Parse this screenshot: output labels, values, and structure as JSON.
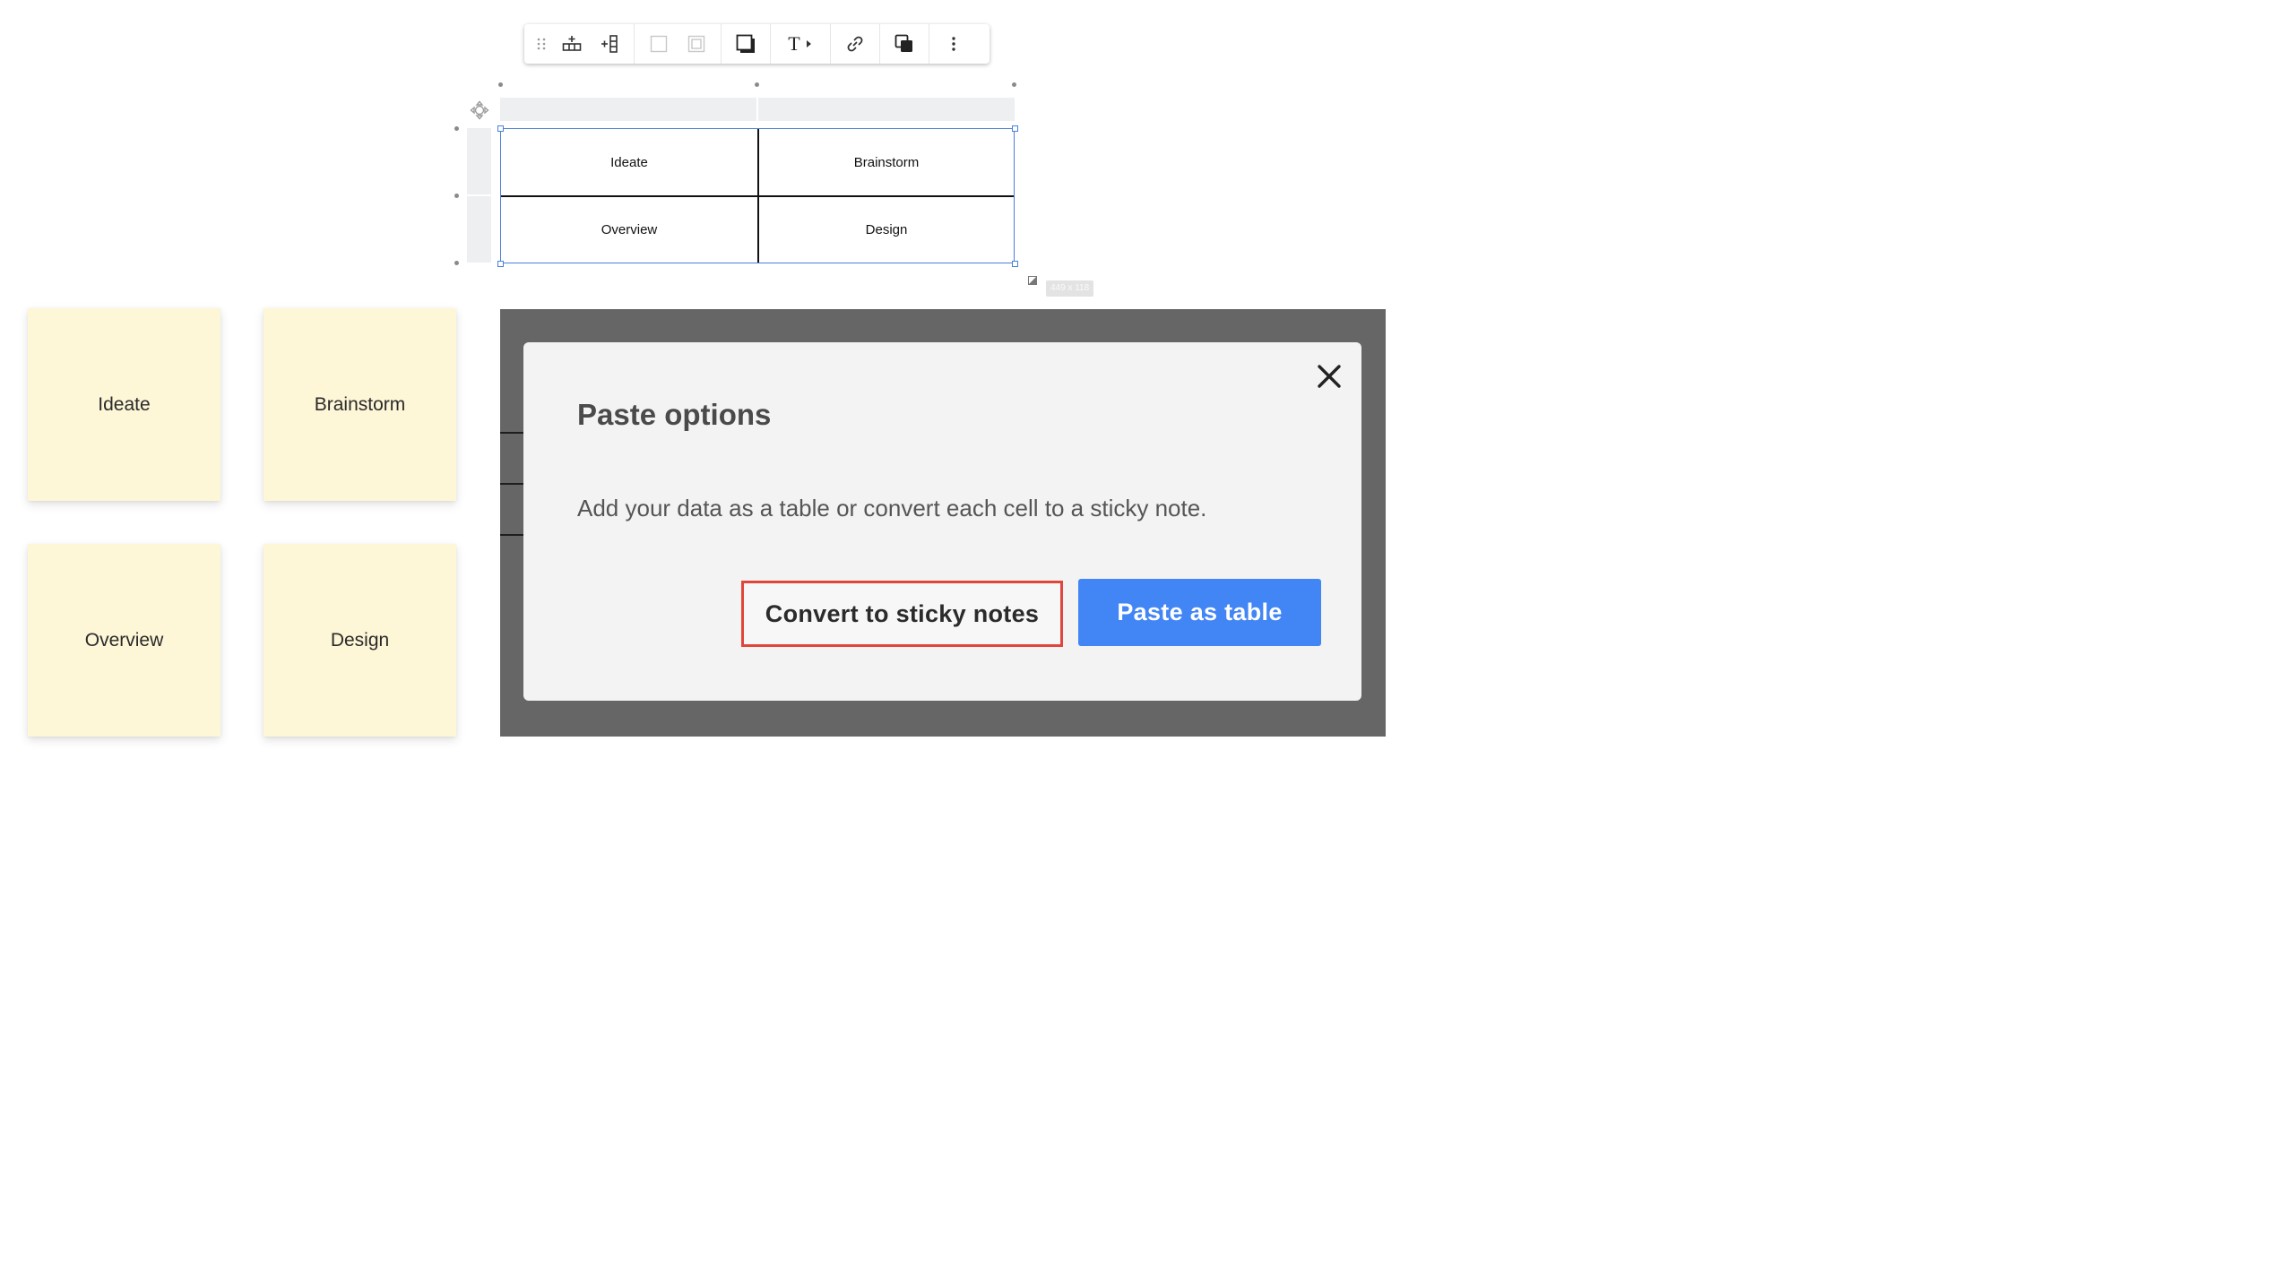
{
  "toolbar": {
    "buttons": [
      {
        "name": "drag-handle-icon"
      },
      {
        "name": "add-row-icon"
      },
      {
        "name": "add-column-icon"
      },
      {
        "name": "cell-fill-icon"
      },
      {
        "name": "border-style-icon"
      },
      {
        "name": "shadow-icon"
      },
      {
        "name": "text-style-icon"
      },
      {
        "name": "link-icon"
      },
      {
        "name": "layer-order-icon"
      },
      {
        "name": "more-options-icon"
      }
    ],
    "text_button_glyph": "T"
  },
  "table": {
    "rows": [
      [
        "Ideate",
        "Brainstorm"
      ],
      [
        "Overview",
        "Design"
      ]
    ],
    "size_label": "449 x 118",
    "selection_color": "#4a80d9"
  },
  "stickies": [
    {
      "label": "Ideate"
    },
    {
      "label": "Brainstorm"
    },
    {
      "label": "Overview"
    },
    {
      "label": "Design"
    }
  ],
  "sticky_color": "#fdf6d7",
  "modal": {
    "title": "Paste options",
    "description": "Add your data as a table or convert each cell to a sticky note.",
    "convert_button": "Convert to sticky notes",
    "paste_button": "Paste as table",
    "close_icon": "close-icon",
    "accent_color": "#4285f4",
    "highlight_color": "#e0463b"
  }
}
